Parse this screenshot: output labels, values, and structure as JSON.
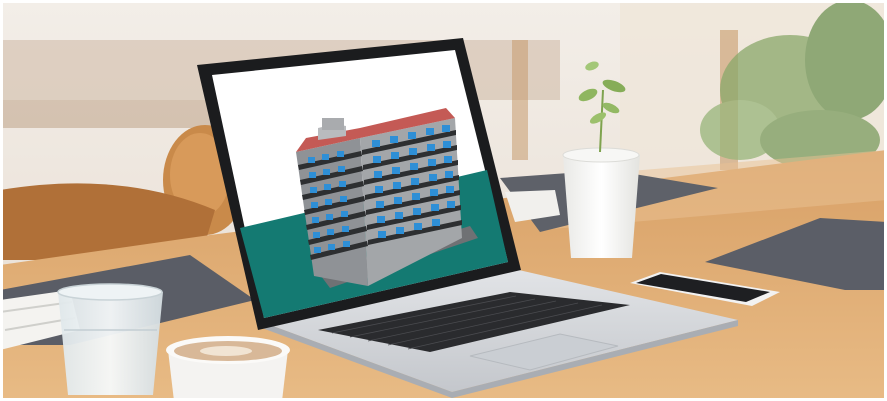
{
  "scene": {
    "subject": "laptop-on-cafe-table",
    "screen_content": "3d-building-model",
    "colors": {
      "table_wood": "#d9a46f",
      "screen_ground": "#147a72",
      "building_wall": "#9ea0a3",
      "building_windows": "#2e8fd6",
      "building_roof": "#c45a55",
      "placemat": "#5a5d66",
      "laptop_body": "#d6d8dc"
    }
  }
}
